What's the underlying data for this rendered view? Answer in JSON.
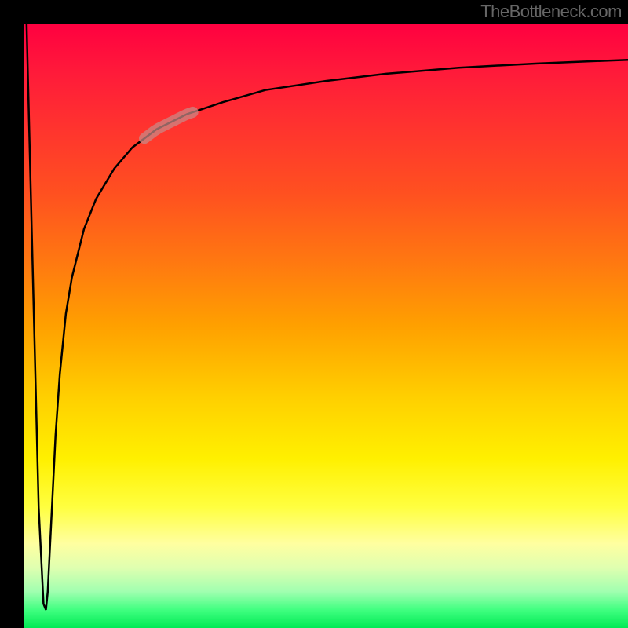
{
  "attribution": "TheBottleneck.com",
  "colors": {
    "page_bg": "#000000",
    "text": "#666666",
    "curve": "#000000",
    "marker": "#c88a88"
  },
  "chart_data": {
    "type": "line",
    "title": "",
    "xlabel": "",
    "ylabel": "",
    "xlim": [
      0,
      100
    ],
    "ylim": [
      0,
      100
    ],
    "grid": false,
    "legend": false,
    "series": [
      {
        "name": "bottleneck-curve",
        "x": [
          0.5,
          1.5,
          2.5,
          3.3,
          3.7,
          4,
          4.6,
          5.3,
          6,
          7,
          8,
          10,
          12,
          15,
          18,
          22,
          27,
          33,
          40,
          50,
          60,
          72,
          85,
          100
        ],
        "y": [
          100,
          60,
          20,
          4,
          3,
          6,
          18,
          32,
          42,
          52,
          58,
          66,
          71,
          76,
          79.5,
          82.5,
          85,
          87,
          89,
          90.5,
          91.7,
          92.7,
          93.4,
          94
        ]
      }
    ],
    "annotations": [
      {
        "name": "highlight-segment",
        "x_range": [
          20,
          28
        ],
        "note": "rosy highlighted band on curve"
      }
    ],
    "background_gradient": [
      {
        "stop": 0.0,
        "color": "#ff0040"
      },
      {
        "stop": 0.5,
        "color": "#ffa000"
      },
      {
        "stop": 0.85,
        "color": "#ffffa0"
      },
      {
        "stop": 1.0,
        "color": "#00ea55"
      }
    ]
  }
}
